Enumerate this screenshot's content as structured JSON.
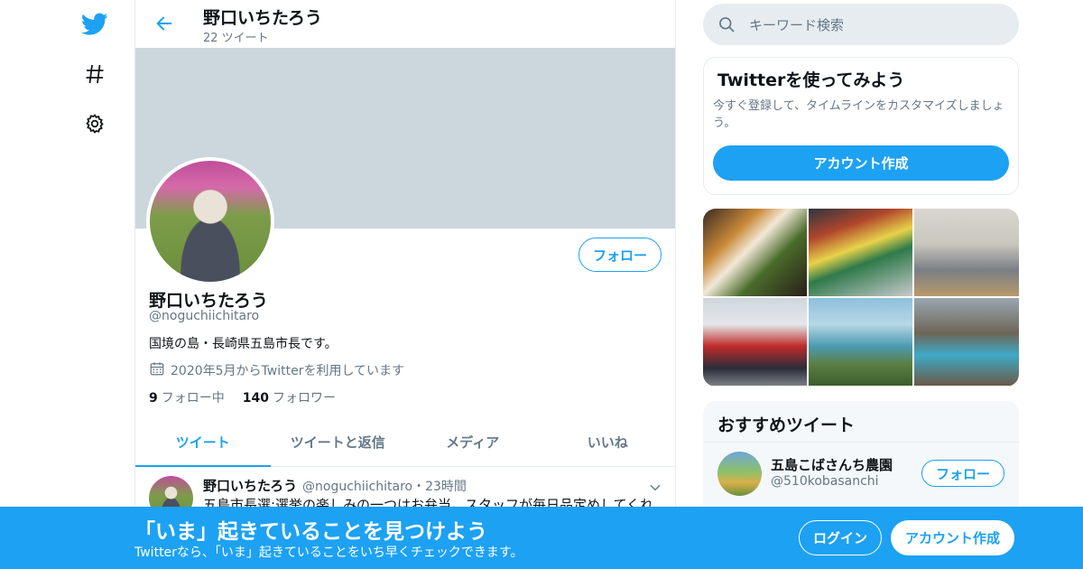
{
  "colors": {
    "accent": "#1da1f2",
    "muted": "#657786",
    "banner": "#ccd6dd",
    "border": "#e6ecf0"
  },
  "nav": {
    "icons": [
      "twitter-bird-icon",
      "hashtag-icon",
      "gear-icon"
    ]
  },
  "header": {
    "name": "野口いちたろう",
    "tweet_count": "22 ツイート"
  },
  "profile": {
    "name": "野口いちたろう",
    "handle": "@noguchiichitaro",
    "bio": "国境の島・長崎県五島市長です。",
    "joined": "2020年5月からTwitterを利用しています",
    "following_count": "9",
    "following_label": "フォロー中",
    "followers_count": "140",
    "followers_label": "フォロワー",
    "follow_label": "フォロー"
  },
  "tabs": [
    {
      "label": "ツイート",
      "active": true
    },
    {
      "label": "ツイートと返信",
      "active": false
    },
    {
      "label": "メディア",
      "active": false
    },
    {
      "label": "いいね",
      "active": false
    }
  ],
  "tweet": {
    "name": "野口いちたろう",
    "handle_time": "@noguchiichitaro・23時間",
    "text": "五島市長選:選挙の楽しみの一つはお弁当。スタッフが毎日品定めしてくれ"
  },
  "search": {
    "placeholder": "キーワード検索"
  },
  "signup_card": {
    "title": "Twitterを使ってみよう",
    "description": "今すぐ登録して、タイムラインをカスタマイズしましょう。",
    "button": "アカウント作成"
  },
  "recommended": {
    "title": "おすすめツイート",
    "user": {
      "name": "五島こばさんち農園",
      "handle": "@510kobasanchi",
      "follow_label": "フォロー"
    }
  },
  "bottom_bar": {
    "title": "「いま」起きていることを見つけよう",
    "subtitle": "Twitterなら、「いま」起きていることをいち早くチェックできます。",
    "login": "ログイン",
    "signup": "アカウント作成"
  }
}
